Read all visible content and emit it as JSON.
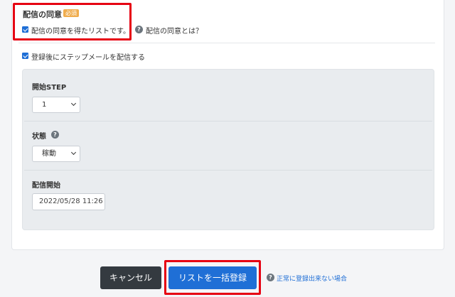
{
  "consent": {
    "title": "配信の同意",
    "required_badge": "必須",
    "checkbox_label": "配信の同意を得たリストです。",
    "help_link": "配信の同意とは？"
  },
  "stepmail": {
    "checkbox_label": "登録後にステップメールを配信する",
    "start_step": {
      "label": "開始STEP",
      "value": "1"
    },
    "status": {
      "label": "状態",
      "value": "稼動"
    },
    "start_delivery": {
      "label": "配信開始",
      "value": "2022/05/28 11:26"
    }
  },
  "actions": {
    "cancel_label": "キャンセル",
    "submit_label": "リストを一括登録",
    "help_link": "正常に登録出来ない場合"
  },
  "colors": {
    "primary": "#1f6fd6",
    "dark": "#343a40",
    "highlight": "#e60012",
    "badge": "#f0ad4e"
  },
  "icons": {
    "help": "question-circle-icon",
    "dropdown": "chevron-down-icon"
  }
}
